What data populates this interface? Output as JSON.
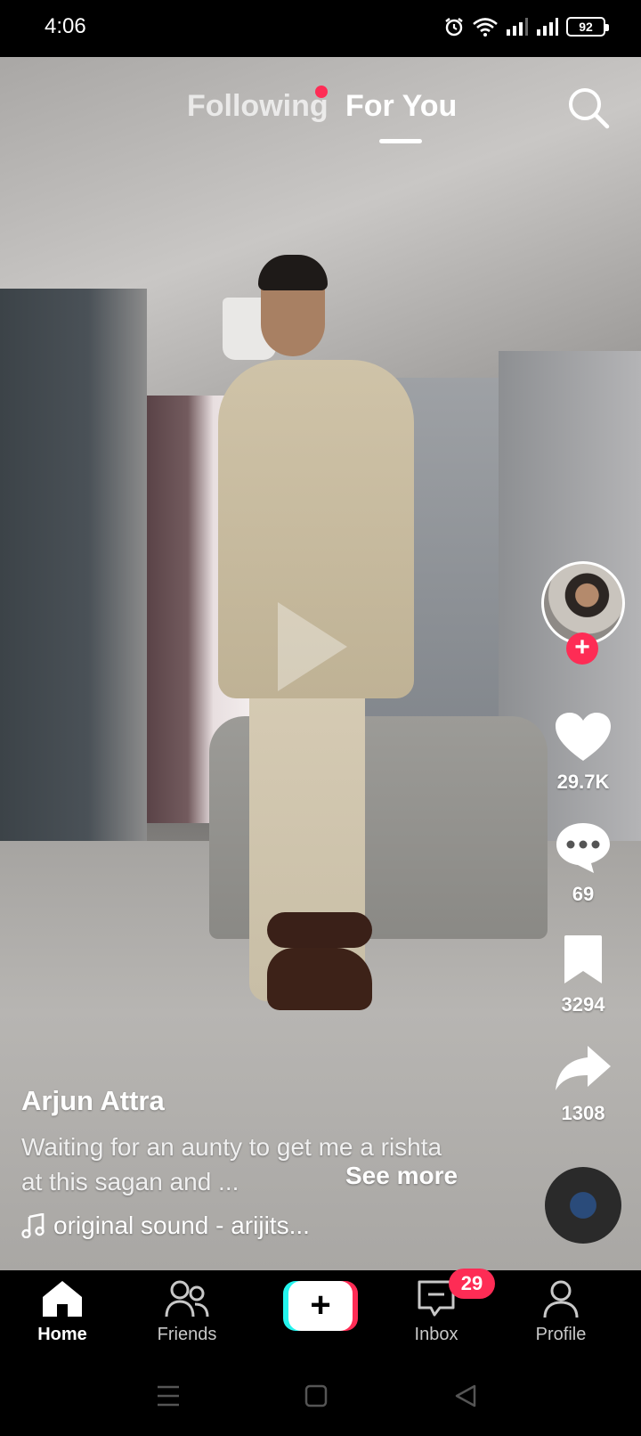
{
  "status_bar": {
    "time": "4:06",
    "battery": "92"
  },
  "top_tabs": {
    "following": "Following",
    "for_you": "For You"
  },
  "video": {
    "author": "Arjun Attra",
    "description": "Waiting for an aunty to get me a rishta at this sagan and ...",
    "see_more": "See more",
    "sound": "original sound - arijits..."
  },
  "actions": {
    "likes": "29.7K",
    "comments": "69",
    "saves": "3294",
    "shares": "1308"
  },
  "bottom_nav": {
    "home": "Home",
    "friends": "Friends",
    "inbox": "Inbox",
    "inbox_badge": "29",
    "profile": "Profile"
  },
  "icons": {
    "status": [
      "alarm-icon",
      "wifi-icon",
      "signal-icon",
      "signal-icon",
      "battery-icon"
    ],
    "top": [
      "search-icon"
    ],
    "side": [
      "heart-icon",
      "comment-icon",
      "bookmark-icon",
      "share-icon",
      "music-disc-icon"
    ],
    "nav": [
      "home-icon",
      "friends-icon",
      "create-icon",
      "inbox-icon",
      "profile-icon"
    ],
    "system": [
      "menu-icon",
      "home-square-icon",
      "back-triangle-icon"
    ]
  },
  "colors": {
    "accent": "#fe2c55",
    "create_cyan": "#25f4ee",
    "background": "#000000",
    "text": "#ffffff"
  }
}
